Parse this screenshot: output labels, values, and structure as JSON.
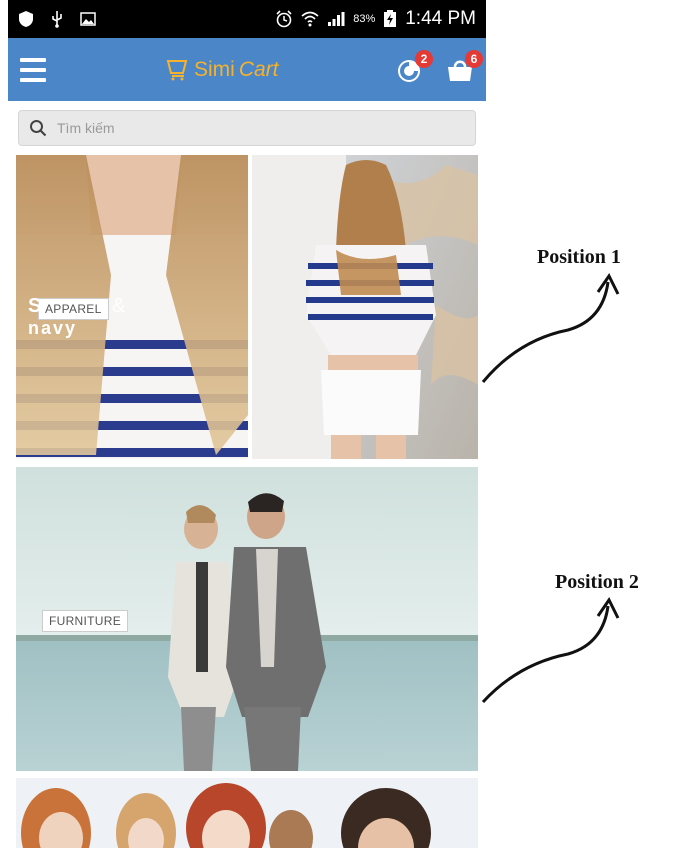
{
  "status_bar": {
    "battery": "83%",
    "time": "1:44 PM"
  },
  "app_bar": {
    "logo_part1": "Simi",
    "logo_part2": "Cart",
    "notification_count": "2",
    "cart_count": "6"
  },
  "search": {
    "placeholder": "Tìm kiếm"
  },
  "banners": [
    {
      "label": "APPAREL",
      "overlay_text_1": "S",
      "overlay_text_2": "&",
      "overlay_text_3": "navy"
    },
    {
      "label": "FURNITURE"
    },
    {
      "label": ""
    }
  ],
  "annotations": {
    "position1": "Position 1",
    "position2": "Position 2"
  },
  "colors": {
    "app_bar": "#4a86c8",
    "logo": "#f6b22c",
    "badge": "#e53935"
  }
}
